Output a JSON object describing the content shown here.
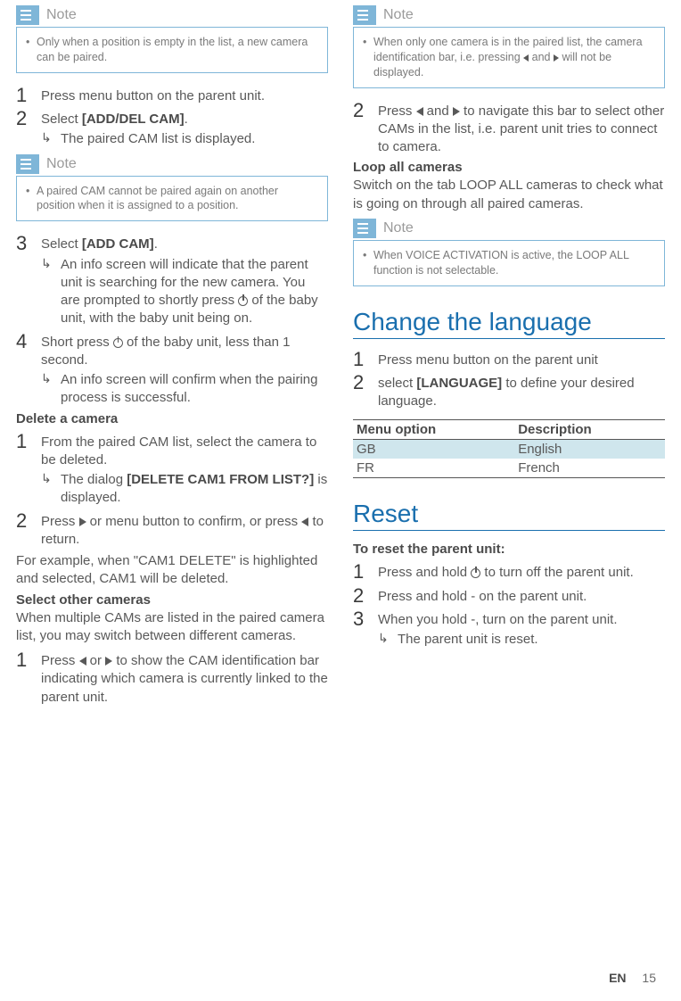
{
  "left": {
    "note1": {
      "label": "Note",
      "items": [
        "Only when a position is empty in the list, a new camera can be paired."
      ]
    },
    "steps_a": [
      {
        "n": "1",
        "text": "Press menu button on the parent unit."
      },
      {
        "n": "2",
        "text_pre": "Select ",
        "bold": "[ADD/DEL CAM]",
        "text_post": ".",
        "sub": "The paired CAM list is displayed."
      }
    ],
    "note2": {
      "label": "Note",
      "items": [
        "A paired CAM cannot be paired again on another position when it is assigned to a position."
      ]
    },
    "steps_b": [
      {
        "n": "3",
        "text_pre": "Select ",
        "bold": "[ADD CAM]",
        "text_post": ".",
        "sub": "An info screen will indicate that the parent unit is searching for the new camera. You are prompted to shortly press {power} of the baby unit, with the baby unit being on."
      },
      {
        "n": "4",
        "text": "Short press {power} of the baby unit, less than 1 second.",
        "sub": "An info screen will confirm when the pairing process is successful."
      }
    ],
    "delete_head": "Delete a camera",
    "steps_c": [
      {
        "n": "1",
        "text": "From the paired CAM list, select the camera to be deleted.",
        "sub_pre": "The dialog ",
        "sub_bold": "[DELETE CAM1 FROM LIST?]",
        "sub_post": " is displayed."
      },
      {
        "n": "2",
        "text": "Press {right} or menu button to confirm, or press {left} to return."
      }
    ],
    "delete_para": "For example, when \"CAM1 DELETE\" is highlighted and selected, CAM1 will be deleted.",
    "select_head": "Select other cameras",
    "select_para": "When multiple CAMs are listed in the paired camera list, you may switch between different cameras.",
    "steps_d": [
      {
        "n": "1",
        "text": "Press {left} or {right} to show the CAM identification bar indicating which camera is currently linked to the parent unit."
      }
    ]
  },
  "right": {
    "note3": {
      "label": "Note",
      "items": [
        "When only one camera is in the paired list, the camera identification bar, i.e. pressing {left} and {right} will not be displayed."
      ]
    },
    "steps_e": [
      {
        "n": "2",
        "text": "Press {left} and {right} to navigate this bar to select other CAMs in the list, i.e. parent unit tries to connect to camera."
      }
    ],
    "loop_head": "Loop all cameras",
    "loop_para": "Switch on the tab LOOP ALL cameras to check what is going on through all paired cameras.",
    "note4": {
      "label": "Note",
      "items": [
        "When VOICE ACTIVATION is active, the LOOP ALL function is not selectable."
      ]
    },
    "h_lang": "Change the language",
    "steps_f": [
      {
        "n": "1",
        "text": "Press menu button on the parent unit"
      },
      {
        "n": "2",
        "text_pre": "select ",
        "bold": "[LANGUAGE]",
        "text_post": " to define your desired language."
      }
    ],
    "table": {
      "headers": [
        "Menu option",
        "Description"
      ],
      "rows": [
        {
          "cells": [
            "GB",
            "English"
          ],
          "hl": true
        },
        {
          "cells": [
            "FR",
            "French"
          ],
          "hl": false
        }
      ]
    },
    "h_reset": "Reset",
    "reset_sub": "To reset the parent unit:",
    "steps_g": [
      {
        "n": "1",
        "text": "Press and hold {power} to turn off the parent unit."
      },
      {
        "n": "2",
        "text": "Press and hold - on the parent unit."
      },
      {
        "n": "3",
        "text": "When you hold -, turn on the parent unit.",
        "sub": "The parent unit is reset."
      }
    ]
  },
  "footer": {
    "lang": "EN",
    "page": "15"
  }
}
